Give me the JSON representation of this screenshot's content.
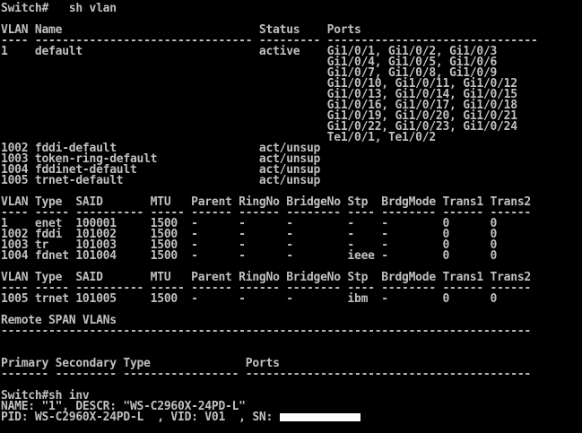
{
  "colors": {
    "background": "#000000",
    "foreground": "#c0c0c0",
    "redaction": "#ffffff"
  },
  "terminal": {
    "lines": [
      "Switch#   sh vlan",
      "",
      "VLAN Name                             Status    Ports",
      "---- -------------------------------- --------- -------------------------------",
      "1    default                          active    Gi1/0/1, Gi1/0/2, Gi1/0/3",
      "                                                Gi1/0/4, Gi1/0/5, Gi1/0/6",
      "                                                Gi1/0/7, Gi1/0/8, Gi1/0/9",
      "                                                Gi1/0/10, Gi1/0/11, Gi1/0/12",
      "                                                Gi1/0/13, Gi1/0/14, Gi1/0/15",
      "                                                Gi1/0/16, Gi1/0/17, Gi1/0/18",
      "                                                Gi1/0/19, Gi1/0/20, Gi1/0/21",
      "                                                Gi1/0/22, Gi1/0/23, Gi1/0/24",
      "                                                Te1/0/1, Te1/0/2",
      "1002 fddi-default                     act/unsup",
      "1003 token-ring-default               act/unsup",
      "1004 fddinet-default                  act/unsup",
      "1005 trnet-default                    act/unsup",
      "",
      "VLAN Type  SAID       MTU   Parent RingNo BridgeNo Stp  BrdgMode Trans1 Trans2",
      "---- ----- ---------- ----- ------ ------ -------- ---- -------- ------ ------",
      "1    enet  100001     1500  -      -      -        -    -        0      0",
      "1002 fddi  101002     1500  -      -      -        -    -        0      0",
      "1003 tr    101003     1500  -      -      -        -    -        0      0",
      "1004 fdnet 101004     1500  -      -      -        ieee -        0      0",
      "",
      "VLAN Type  SAID       MTU   Parent RingNo BridgeNo Stp  BrdgMode Trans1 Trans2",
      "---- ----- ---------- ----- ------ ------ -------- ---- -------- ------ ------",
      "1005 trnet 101005     1500  -      -      -        ibm  -        0      0",
      "",
      "Remote SPAN VLANs",
      "------------------------------------------------------------------------------",
      "",
      "",
      "Primary Secondary Type              Ports",
      "------- --------- ----------------- ------------------------------------------",
      "",
      "Switch#sh inv",
      "NAME: \"1\", DESCR: \"WS-C2960X-24PD-L\"",
      "PID: WS-C2960X-24PD-L  , VID: V01  , SN: "
    ]
  }
}
